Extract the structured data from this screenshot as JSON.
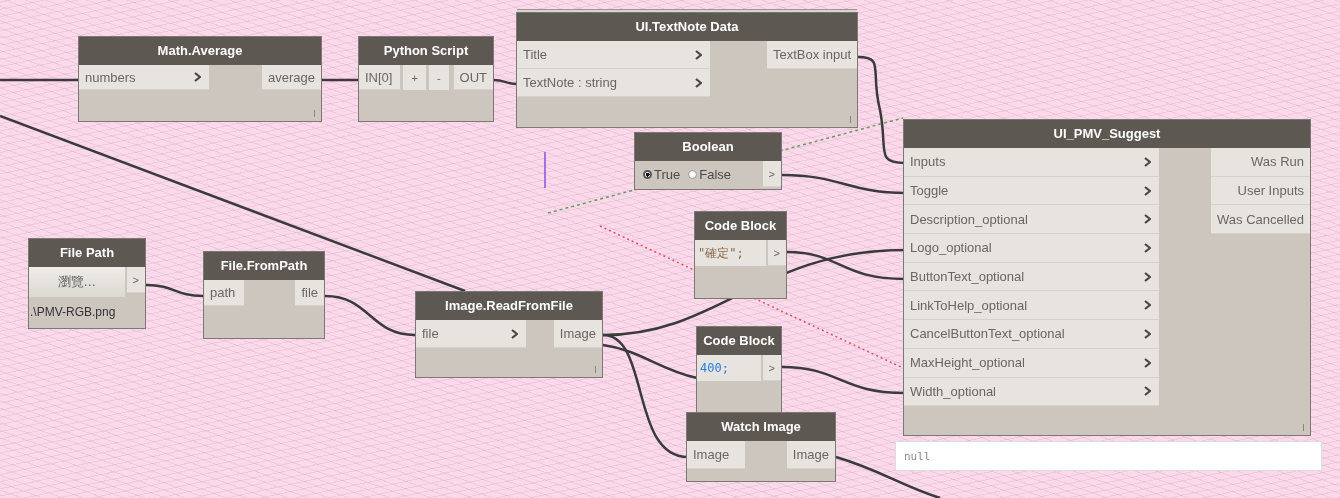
{
  "nodes": [
    {
      "kind": "standard",
      "title": "Math.Average",
      "inputs": [
        {
          "label": "numbers",
          "chevron": true
        }
      ],
      "outputs": [
        "average"
      ],
      "lacing": true
    },
    {
      "kind": "python",
      "title": "Python Script",
      "inputs": [
        {
          "label": "IN[0]",
          "chevron": false
        }
      ],
      "buttons": [
        "+",
        "-"
      ],
      "outputs": [
        "OUT"
      ],
      "lacing": false
    },
    {
      "kind": "standard",
      "title": "UI.TextNote Data",
      "inputs": [
        {
          "label": "Title",
          "chevron": true
        },
        {
          "label": "TextNote : string",
          "chevron": true
        }
      ],
      "outputs": [
        "TextBox input"
      ],
      "lacing": true
    },
    {
      "kind": "boolean",
      "title": "Boolean",
      "options": [
        {
          "label": "True",
          "selected": true
        },
        {
          "label": "False",
          "selected": false
        }
      ],
      "output": ">"
    },
    {
      "kind": "standard",
      "title": "UI_PMV_Suggest",
      "inputs": [
        {
          "label": "Inputs",
          "chevron": true
        },
        {
          "label": "Toggle",
          "chevron": true
        },
        {
          "label": "Description_optional",
          "chevron": true
        },
        {
          "label": "Logo_optional",
          "chevron": true
        },
        {
          "label": "ButtonText_optional",
          "chevron": true
        },
        {
          "label": "LinkToHelp_optional",
          "chevron": true
        },
        {
          "label": "CancelButtonText_optional",
          "chevron": true
        },
        {
          "label": "MaxHeight_optional",
          "chevron": true
        },
        {
          "label": "Width_optional",
          "chevron": true
        }
      ],
      "outputs": [
        "Was Run",
        "User Inputs",
        "Was Cancelled"
      ],
      "lacing": true
    },
    {
      "kind": "filepath",
      "title": "File Path",
      "button": "瀏覽...",
      "output": ">",
      "path": ".\\PMV-RGB.png"
    },
    {
      "kind": "standard",
      "title": "File.FromPath",
      "inputs": [
        {
          "label": "path",
          "chevron": false
        }
      ],
      "outputs": [
        "file"
      ],
      "lacing": false
    },
    {
      "kind": "standard",
      "title": "Image.ReadFromFile",
      "inputs": [
        {
          "label": "file",
          "chevron": true
        }
      ],
      "outputs": [
        "Image"
      ],
      "lacing": true
    },
    {
      "kind": "code",
      "title": "Code Block",
      "code": "\"確定\";",
      "color": "#8a6a4a",
      "output": ">"
    },
    {
      "kind": "code",
      "title": "Code Block",
      "code": "400;",
      "color": "#2a7de0",
      "output": ">"
    },
    {
      "kind": "standard",
      "title": "Watch Image",
      "inputs": [
        {
          "label": "Image",
          "chevron": false
        }
      ],
      "outputs": [
        "Image"
      ],
      "lacing": false
    }
  ],
  "watch_preview": {
    "text": "null"
  }
}
